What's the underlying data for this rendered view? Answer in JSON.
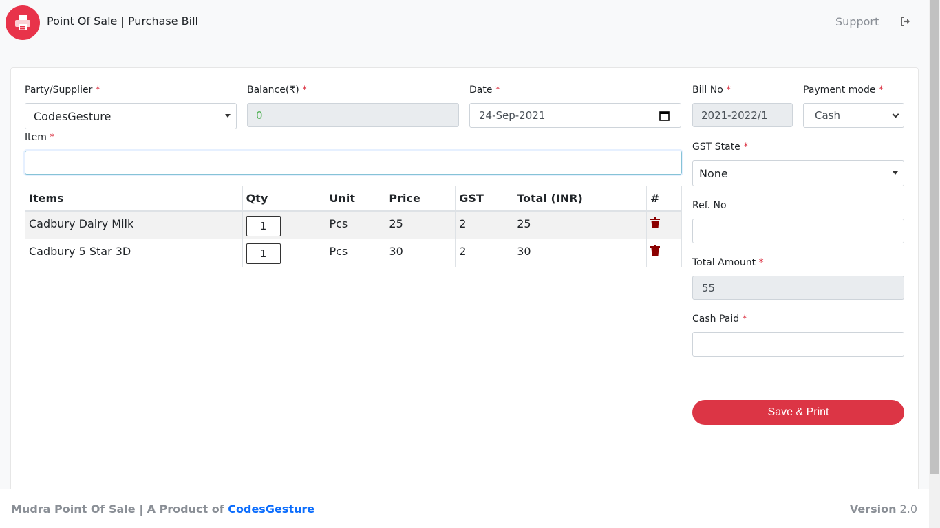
{
  "header": {
    "title": "Point Of Sale | Purchase Bill",
    "support_label": "Support"
  },
  "form": {
    "party": {
      "label": "Party/Supplier",
      "value": "CodesGesture"
    },
    "balance": {
      "label": "Balance(₹)",
      "value": "0"
    },
    "date": {
      "label": "Date",
      "value": "24-Sep-2021"
    },
    "item": {
      "label": "Item",
      "value": ""
    },
    "required_mark": "*"
  },
  "table": {
    "headers": [
      "Items",
      "Qty",
      "Unit",
      "Price",
      "GST",
      "Total (INR)",
      "#"
    ],
    "rows": [
      {
        "item": "Cadbury Dairy Milk",
        "qty": "1",
        "unit": "Pcs",
        "price": "25",
        "gst": "2",
        "total": "25"
      },
      {
        "item": "Cadbury 5 Star 3D",
        "qty": "1",
        "unit": "Pcs",
        "price": "30",
        "gst": "2",
        "total": "30"
      }
    ]
  },
  "side": {
    "bill_no": {
      "label": "Bill No",
      "value": "2021-2022/1"
    },
    "payment_mode": {
      "label": "Payment mode",
      "value": "Cash"
    },
    "gst_state": {
      "label": "GST State",
      "value": "None"
    },
    "ref_no": {
      "label": "Ref. No",
      "value": ""
    },
    "total_amount": {
      "label": "Total Amount",
      "value": "55"
    },
    "cash_paid": {
      "label": "Cash Paid",
      "value": ""
    },
    "save_label": "Save & Print"
  },
  "footer": {
    "left_text": "Mudra Point Of Sale | A Product of ",
    "brand": "CodesGesture",
    "version_label": "Version",
    "version_value": "2.0"
  },
  "colors": {
    "accent": "#dc3545",
    "logo_bg": "#e8334a",
    "brand_link": "#0d6efd",
    "balance_text": "#4caf50"
  }
}
